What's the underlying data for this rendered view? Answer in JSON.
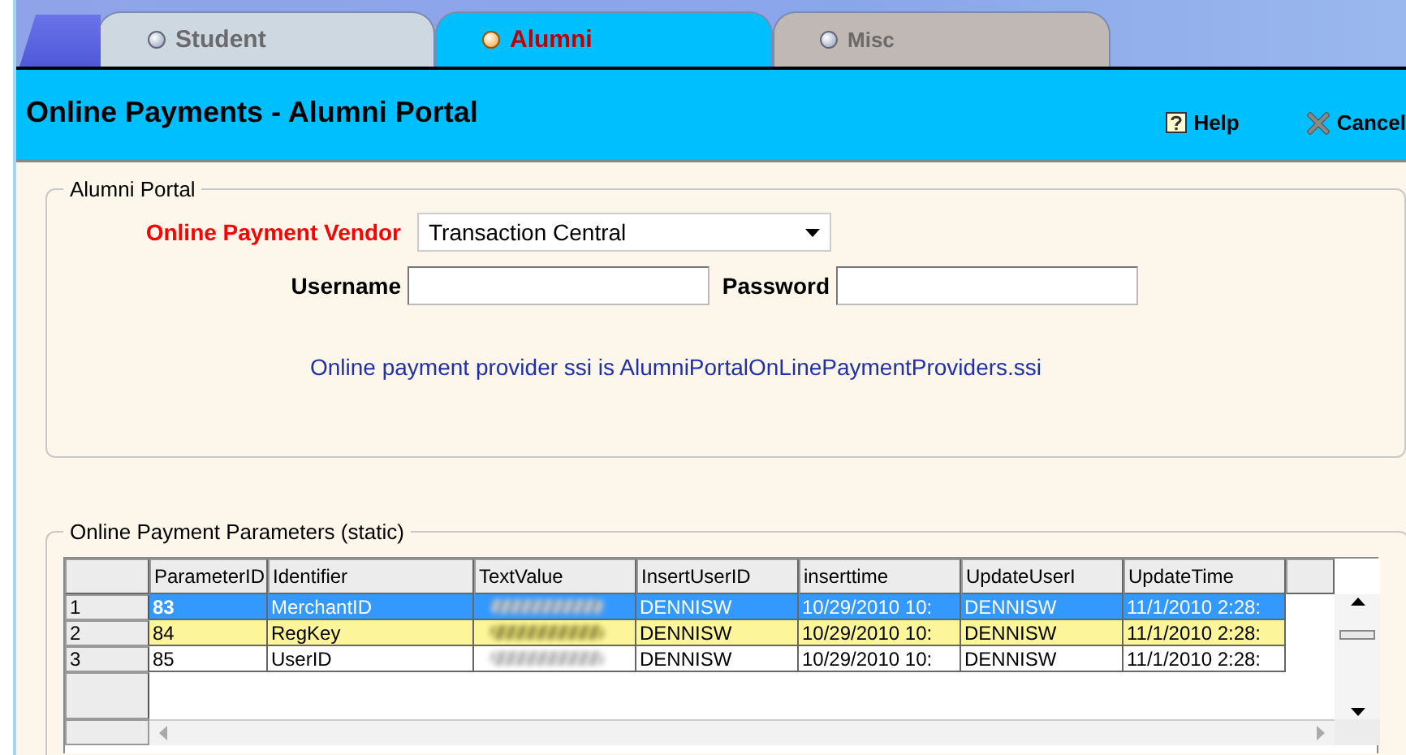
{
  "tabs": [
    {
      "label": "Student",
      "selected": false
    },
    {
      "label": "Alumni",
      "selected": true
    },
    {
      "label": "Misc",
      "selected": false
    }
  ],
  "header": {
    "title": "Online Payments - Alumni Portal",
    "buttons": [
      {
        "kind": "help",
        "label": "Help"
      },
      {
        "kind": "cancel",
        "label": "Cancel"
      }
    ]
  },
  "portal": {
    "legend": "Alumni Portal",
    "vendor_label": "Online Payment Vendor",
    "vendor_value": "Transaction Central",
    "username_label": "Username",
    "password_label": "Password",
    "info": "Online payment provider ssi is AlumniPortalOnLinePaymentProviders.ssi"
  },
  "parameters": {
    "legend": "Online Payment Parameters (static)",
    "columns": [
      "ParameterID",
      "Identifier",
      "TextValue",
      "InsertUserID",
      "inserttime",
      "UpdateUserI",
      "UpdateTime"
    ],
    "rows": [
      {
        "number": "1",
        "parameter_id": "83",
        "identifier": "MerchantID",
        "insert_user_id": "DENNISW",
        "insert_time": "10/29/2010 10:",
        "update_user_id": "DENNISW",
        "update_time": "11/1/2010 2:28:",
        "selected": true,
        "highlighted": false
      },
      {
        "number": "2",
        "parameter_id": "84",
        "identifier": "RegKey",
        "insert_user_id": "DENNISW",
        "insert_time": "10/29/2010 10:",
        "update_user_id": "DENNISW",
        "update_time": "11/1/2010 2:28:",
        "selected": false,
        "highlighted": true
      },
      {
        "number": "3",
        "parameter_id": "85",
        "identifier": "UserID",
        "insert_user_id": "DENNISW",
        "insert_time": "10/29/2010 10:",
        "update_user_id": "DENNISW",
        "update_time": "11/1/2010 2:28:",
        "selected": false,
        "highlighted": false
      }
    ]
  }
}
